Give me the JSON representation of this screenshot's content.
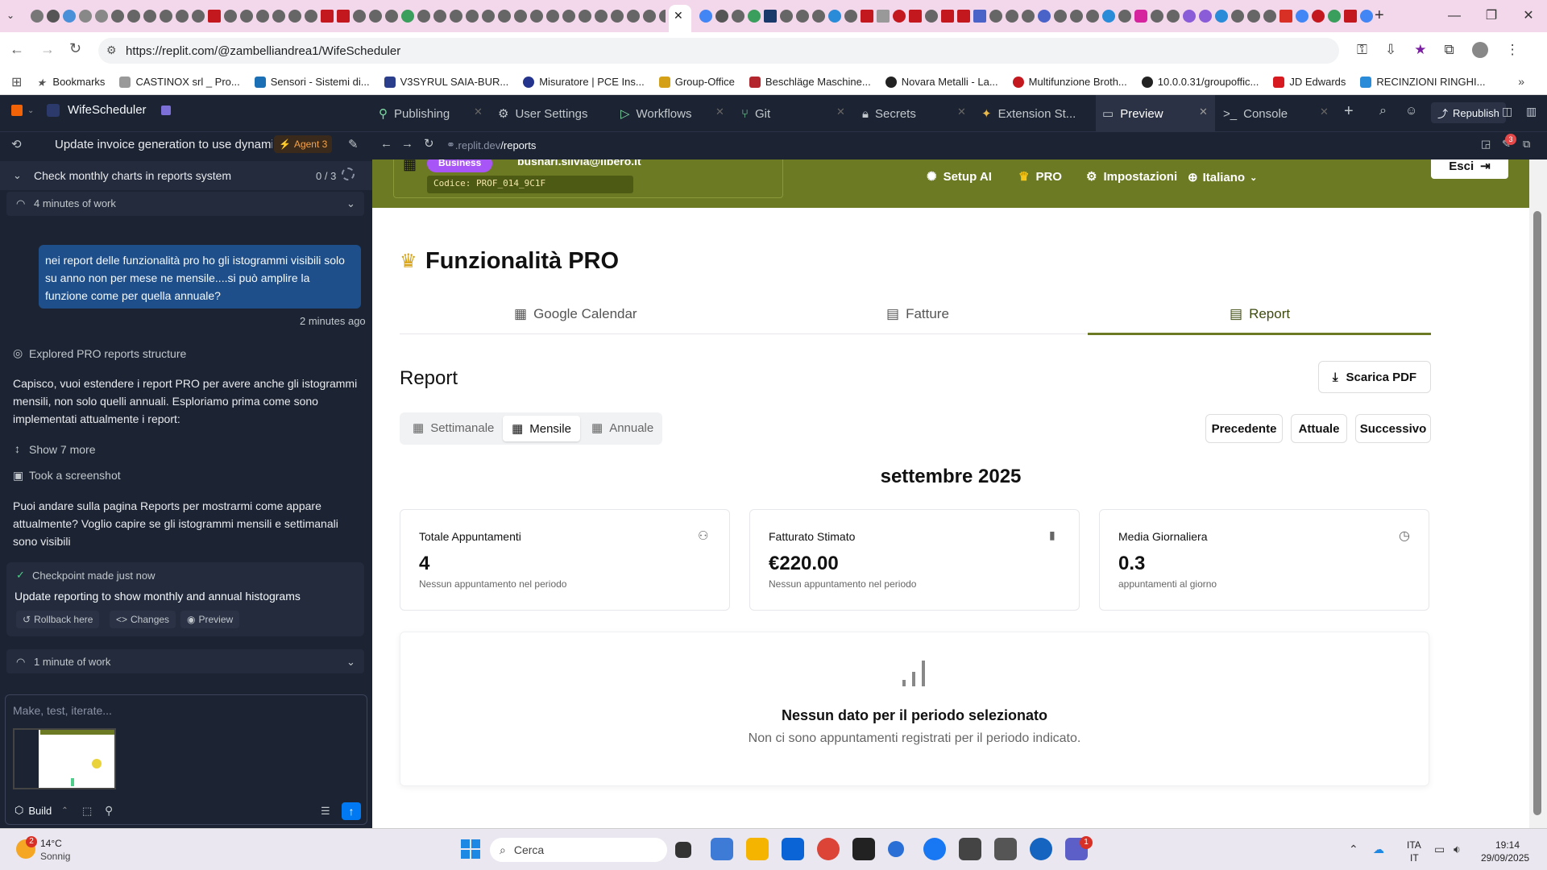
{
  "browser": {
    "active_tab_close": "✕",
    "new_tab": "+",
    "url": "https://replit.com/@zambelliandrea1/WifeScheduler",
    "bookmarks": [
      "Bookmarks",
      "CASTINOX srl _ Pro...",
      "Sensori - Sistemi di...",
      "V3SYRUL SAIA-BUR...",
      "Misuratore | PCE Ins...",
      "Group-Office",
      "Beschläge Maschine...",
      "Novara Metalli - La...",
      "Multifunzione Broth...",
      "10.0.0.31/groupoffic...",
      "JD Edwards",
      "RECINZIONI RINGHI..."
    ]
  },
  "replit": {
    "project": "WifeScheduler",
    "tabs": [
      "Publishing",
      "User Settings",
      "Workflows",
      "Git",
      "Secrets",
      "Extension St...",
      "Preview",
      "Console"
    ],
    "active_tab": "Preview",
    "republish": "Republish",
    "task_title": "Update invoice generation to use dynami...",
    "agent_badge": "Agent 3",
    "checklist": {
      "title": "Check monthly charts in reports system",
      "count": "0 / 3"
    },
    "work1": "4 minutes of work",
    "user_msg": "nei report delle funzionalità pro ho gli istogrammi visibili solo su anno non per mese ne mensile....si può amplire la funzione come per quella annuale?",
    "user_time": "2 minutes ago",
    "explored": "Explored PRO reports structure",
    "agent_msg1": "Capisco, vuoi estendere i report PRO per avere anche gli istogrammi mensili, non solo quelli annuali. Esploriamo prima come sono implementati attualmente i report:",
    "show_more": "Show 7 more",
    "screenshot": "Took a screenshot",
    "agent_msg2": "Puoi andare sulla pagina Reports per mostrarmi come appare attualmente? Voglio capire se gli istogrammi mensili e settimanali sono visibili",
    "checkpoint": "Checkpoint made just now",
    "checkpoint_desc": "Update reporting to show monthly and annual histograms",
    "rollback": "Rollback here",
    "changes": "Changes",
    "preview_btn": "Preview",
    "work2": "1 minute of work",
    "input_placeholder": "Make, test, iterate...",
    "build": "Build",
    "preview_url_pre": ".replit.dev",
    "preview_url_path": "/reports",
    "notif_count": "3"
  },
  "app": {
    "badge": "Business",
    "email": "busnari.silvia@libero.it",
    "code": "Codice: PROF_014_9C1F",
    "nav": {
      "setup_ai": "Setup AI",
      "pro": "PRO",
      "settings": "Impostazioni",
      "language": "Italiano",
      "exit": "Esci"
    },
    "heading": "Funzionalità PRO",
    "tabs": [
      "Google Calendar",
      "Fatture",
      "Report"
    ],
    "report_title": "Report",
    "download": "Scarica PDF",
    "periods": [
      "Settimanale",
      "Mensile",
      "Annuale"
    ],
    "active_period": "Mensile",
    "nav_buttons": [
      "Precedente",
      "Attuale",
      "Successivo"
    ],
    "month": "settembre 2025",
    "stats": [
      {
        "title": "Totale Appuntamenti",
        "value": "4",
        "sub": "Nessun appuntamento nel periodo",
        "icon": "user-check-icon"
      },
      {
        "title": "Fatturato Stimato",
        "value": "€220.00",
        "sub": "Nessun appuntamento nel periodo",
        "icon": "bar-chart-icon"
      },
      {
        "title": "Media Giornaliera",
        "value": "0.3",
        "sub": "appuntamenti al giorno",
        "icon": "clock-icon"
      }
    ],
    "empty_title": "Nessun dato per il periodo selezionato",
    "empty_sub": "Non ci sono appuntamenti registrati per il periodo indicato."
  },
  "taskbar": {
    "weather_temp": "14°C",
    "weather_desc": "Sonnig",
    "weather_badge": "2",
    "search": "Cerca",
    "lang1": "ITA",
    "lang2": "IT",
    "time": "19:14",
    "date": "29/09/2025",
    "teams_badge": "1"
  }
}
